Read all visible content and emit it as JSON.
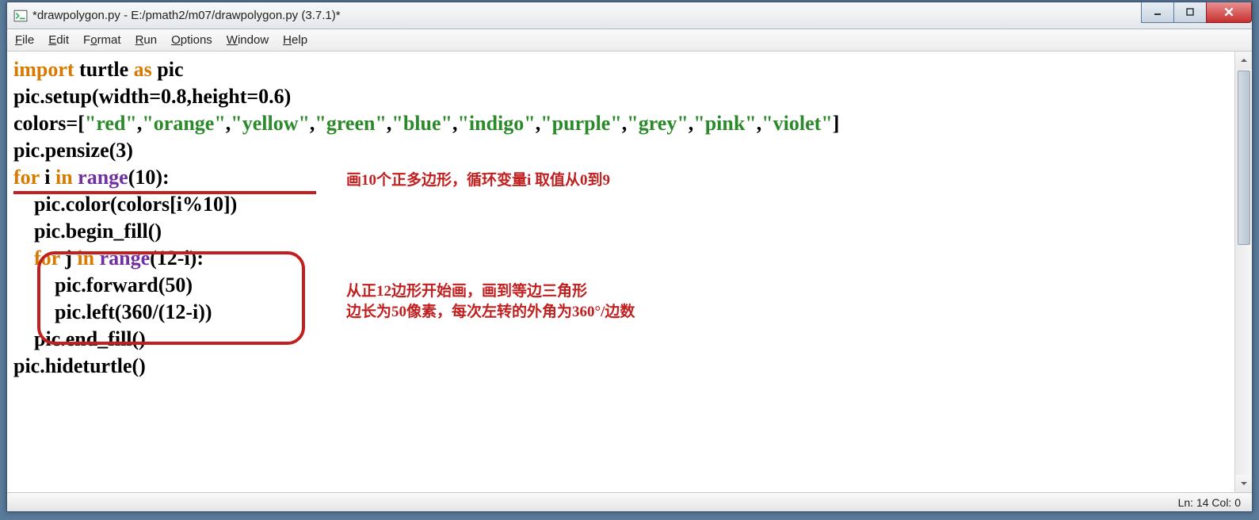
{
  "window": {
    "title": "*drawpolygon.py - E:/pmath2/m07/drawpolygon.py (3.7.1)*"
  },
  "menu": {
    "file": "File",
    "edit": "Edit",
    "format": "Format",
    "run": "Run",
    "options": "Options",
    "window": "Window",
    "help": "Help"
  },
  "code": {
    "l1_import": "import",
    "l1_turtle": " turtle ",
    "l1_as": "as",
    "l1_pic": " pic",
    "l2": "pic.setup(width=0.8,height=0.6)",
    "l3_pre": "colors=[",
    "l3_s0": "\"red\"",
    "l3_s1": "\"orange\"",
    "l3_s2": "\"yellow\"",
    "l3_s3": "\"green\"",
    "l3_s4": "\"blue\"",
    "l3_s5": "\"indigo\"",
    "l3_s6": "\"purple\"",
    "l3_s7": "\"grey\"",
    "l3_s8": "\"pink\"",
    "l3_s9": "\"violet\"",
    "l3_c": ",",
    "l3_post": "]",
    "l4": "pic.pensize(3)",
    "l5_for": "for",
    "l5_i": " i ",
    "l5_in": "in",
    "l5_sp": " ",
    "l5_range": "range",
    "l5_tail": "(10):",
    "l6": "    pic.color(colors[i%10])",
    "l7": "    pic.begin_fill()",
    "l8_ind": "    ",
    "l8_for": "for",
    "l8_j": " j ",
    "l8_in": "in",
    "l8_sp": " ",
    "l8_range": "range",
    "l8_tail": "(12-i):",
    "l9": "        pic.forward(50)",
    "l10": "        pic.left(360/(12-i))",
    "l11": "    pic.end_fill()",
    "l12": "pic.hideturtle()"
  },
  "annotations": {
    "a1": "画10个正多边形，循环变量i 取值从0到9",
    "a2_l1": "从正12边形开始画，画到等边三角形",
    "a2_l2": "边长为50像素，每次左转的外角为360°/边数"
  },
  "status": {
    "text": "Ln: 14  Col: 0"
  }
}
